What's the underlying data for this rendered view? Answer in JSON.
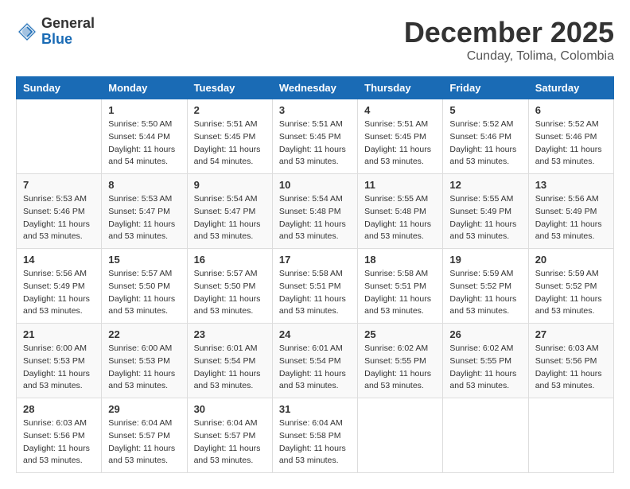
{
  "header": {
    "logo_general": "General",
    "logo_blue": "Blue",
    "month_title": "December 2025",
    "location": "Cunday, Tolima, Colombia"
  },
  "weekdays": [
    "Sunday",
    "Monday",
    "Tuesday",
    "Wednesday",
    "Thursday",
    "Friday",
    "Saturday"
  ],
  "weeks": [
    [
      {
        "day": "",
        "info": ""
      },
      {
        "day": "1",
        "info": "Sunrise: 5:50 AM\nSunset: 5:44 PM\nDaylight: 11 hours\nand 54 minutes."
      },
      {
        "day": "2",
        "info": "Sunrise: 5:51 AM\nSunset: 5:45 PM\nDaylight: 11 hours\nand 54 minutes."
      },
      {
        "day": "3",
        "info": "Sunrise: 5:51 AM\nSunset: 5:45 PM\nDaylight: 11 hours\nand 53 minutes."
      },
      {
        "day": "4",
        "info": "Sunrise: 5:51 AM\nSunset: 5:45 PM\nDaylight: 11 hours\nand 53 minutes."
      },
      {
        "day": "5",
        "info": "Sunrise: 5:52 AM\nSunset: 5:46 PM\nDaylight: 11 hours\nand 53 minutes."
      },
      {
        "day": "6",
        "info": "Sunrise: 5:52 AM\nSunset: 5:46 PM\nDaylight: 11 hours\nand 53 minutes."
      }
    ],
    [
      {
        "day": "7",
        "info": "Sunrise: 5:53 AM\nSunset: 5:46 PM\nDaylight: 11 hours\nand 53 minutes."
      },
      {
        "day": "8",
        "info": "Sunrise: 5:53 AM\nSunset: 5:47 PM\nDaylight: 11 hours\nand 53 minutes."
      },
      {
        "day": "9",
        "info": "Sunrise: 5:54 AM\nSunset: 5:47 PM\nDaylight: 11 hours\nand 53 minutes."
      },
      {
        "day": "10",
        "info": "Sunrise: 5:54 AM\nSunset: 5:48 PM\nDaylight: 11 hours\nand 53 minutes."
      },
      {
        "day": "11",
        "info": "Sunrise: 5:55 AM\nSunset: 5:48 PM\nDaylight: 11 hours\nand 53 minutes."
      },
      {
        "day": "12",
        "info": "Sunrise: 5:55 AM\nSunset: 5:49 PM\nDaylight: 11 hours\nand 53 minutes."
      },
      {
        "day": "13",
        "info": "Sunrise: 5:56 AM\nSunset: 5:49 PM\nDaylight: 11 hours\nand 53 minutes."
      }
    ],
    [
      {
        "day": "14",
        "info": "Sunrise: 5:56 AM\nSunset: 5:49 PM\nDaylight: 11 hours\nand 53 minutes."
      },
      {
        "day": "15",
        "info": "Sunrise: 5:57 AM\nSunset: 5:50 PM\nDaylight: 11 hours\nand 53 minutes."
      },
      {
        "day": "16",
        "info": "Sunrise: 5:57 AM\nSunset: 5:50 PM\nDaylight: 11 hours\nand 53 minutes."
      },
      {
        "day": "17",
        "info": "Sunrise: 5:58 AM\nSunset: 5:51 PM\nDaylight: 11 hours\nand 53 minutes."
      },
      {
        "day": "18",
        "info": "Sunrise: 5:58 AM\nSunset: 5:51 PM\nDaylight: 11 hours\nand 53 minutes."
      },
      {
        "day": "19",
        "info": "Sunrise: 5:59 AM\nSunset: 5:52 PM\nDaylight: 11 hours\nand 53 minutes."
      },
      {
        "day": "20",
        "info": "Sunrise: 5:59 AM\nSunset: 5:52 PM\nDaylight: 11 hours\nand 53 minutes."
      }
    ],
    [
      {
        "day": "21",
        "info": "Sunrise: 6:00 AM\nSunset: 5:53 PM\nDaylight: 11 hours\nand 53 minutes."
      },
      {
        "day": "22",
        "info": "Sunrise: 6:00 AM\nSunset: 5:53 PM\nDaylight: 11 hours\nand 53 minutes."
      },
      {
        "day": "23",
        "info": "Sunrise: 6:01 AM\nSunset: 5:54 PM\nDaylight: 11 hours\nand 53 minutes."
      },
      {
        "day": "24",
        "info": "Sunrise: 6:01 AM\nSunset: 5:54 PM\nDaylight: 11 hours\nand 53 minutes."
      },
      {
        "day": "25",
        "info": "Sunrise: 6:02 AM\nSunset: 5:55 PM\nDaylight: 11 hours\nand 53 minutes."
      },
      {
        "day": "26",
        "info": "Sunrise: 6:02 AM\nSunset: 5:55 PM\nDaylight: 11 hours\nand 53 minutes."
      },
      {
        "day": "27",
        "info": "Sunrise: 6:03 AM\nSunset: 5:56 PM\nDaylight: 11 hours\nand 53 minutes."
      }
    ],
    [
      {
        "day": "28",
        "info": "Sunrise: 6:03 AM\nSunset: 5:56 PM\nDaylight: 11 hours\nand 53 minutes."
      },
      {
        "day": "29",
        "info": "Sunrise: 6:04 AM\nSunset: 5:57 PM\nDaylight: 11 hours\nand 53 minutes."
      },
      {
        "day": "30",
        "info": "Sunrise: 6:04 AM\nSunset: 5:57 PM\nDaylight: 11 hours\nand 53 minutes."
      },
      {
        "day": "31",
        "info": "Sunrise: 6:04 AM\nSunset: 5:58 PM\nDaylight: 11 hours\nand 53 minutes."
      },
      {
        "day": "",
        "info": ""
      },
      {
        "day": "",
        "info": ""
      },
      {
        "day": "",
        "info": ""
      }
    ]
  ]
}
